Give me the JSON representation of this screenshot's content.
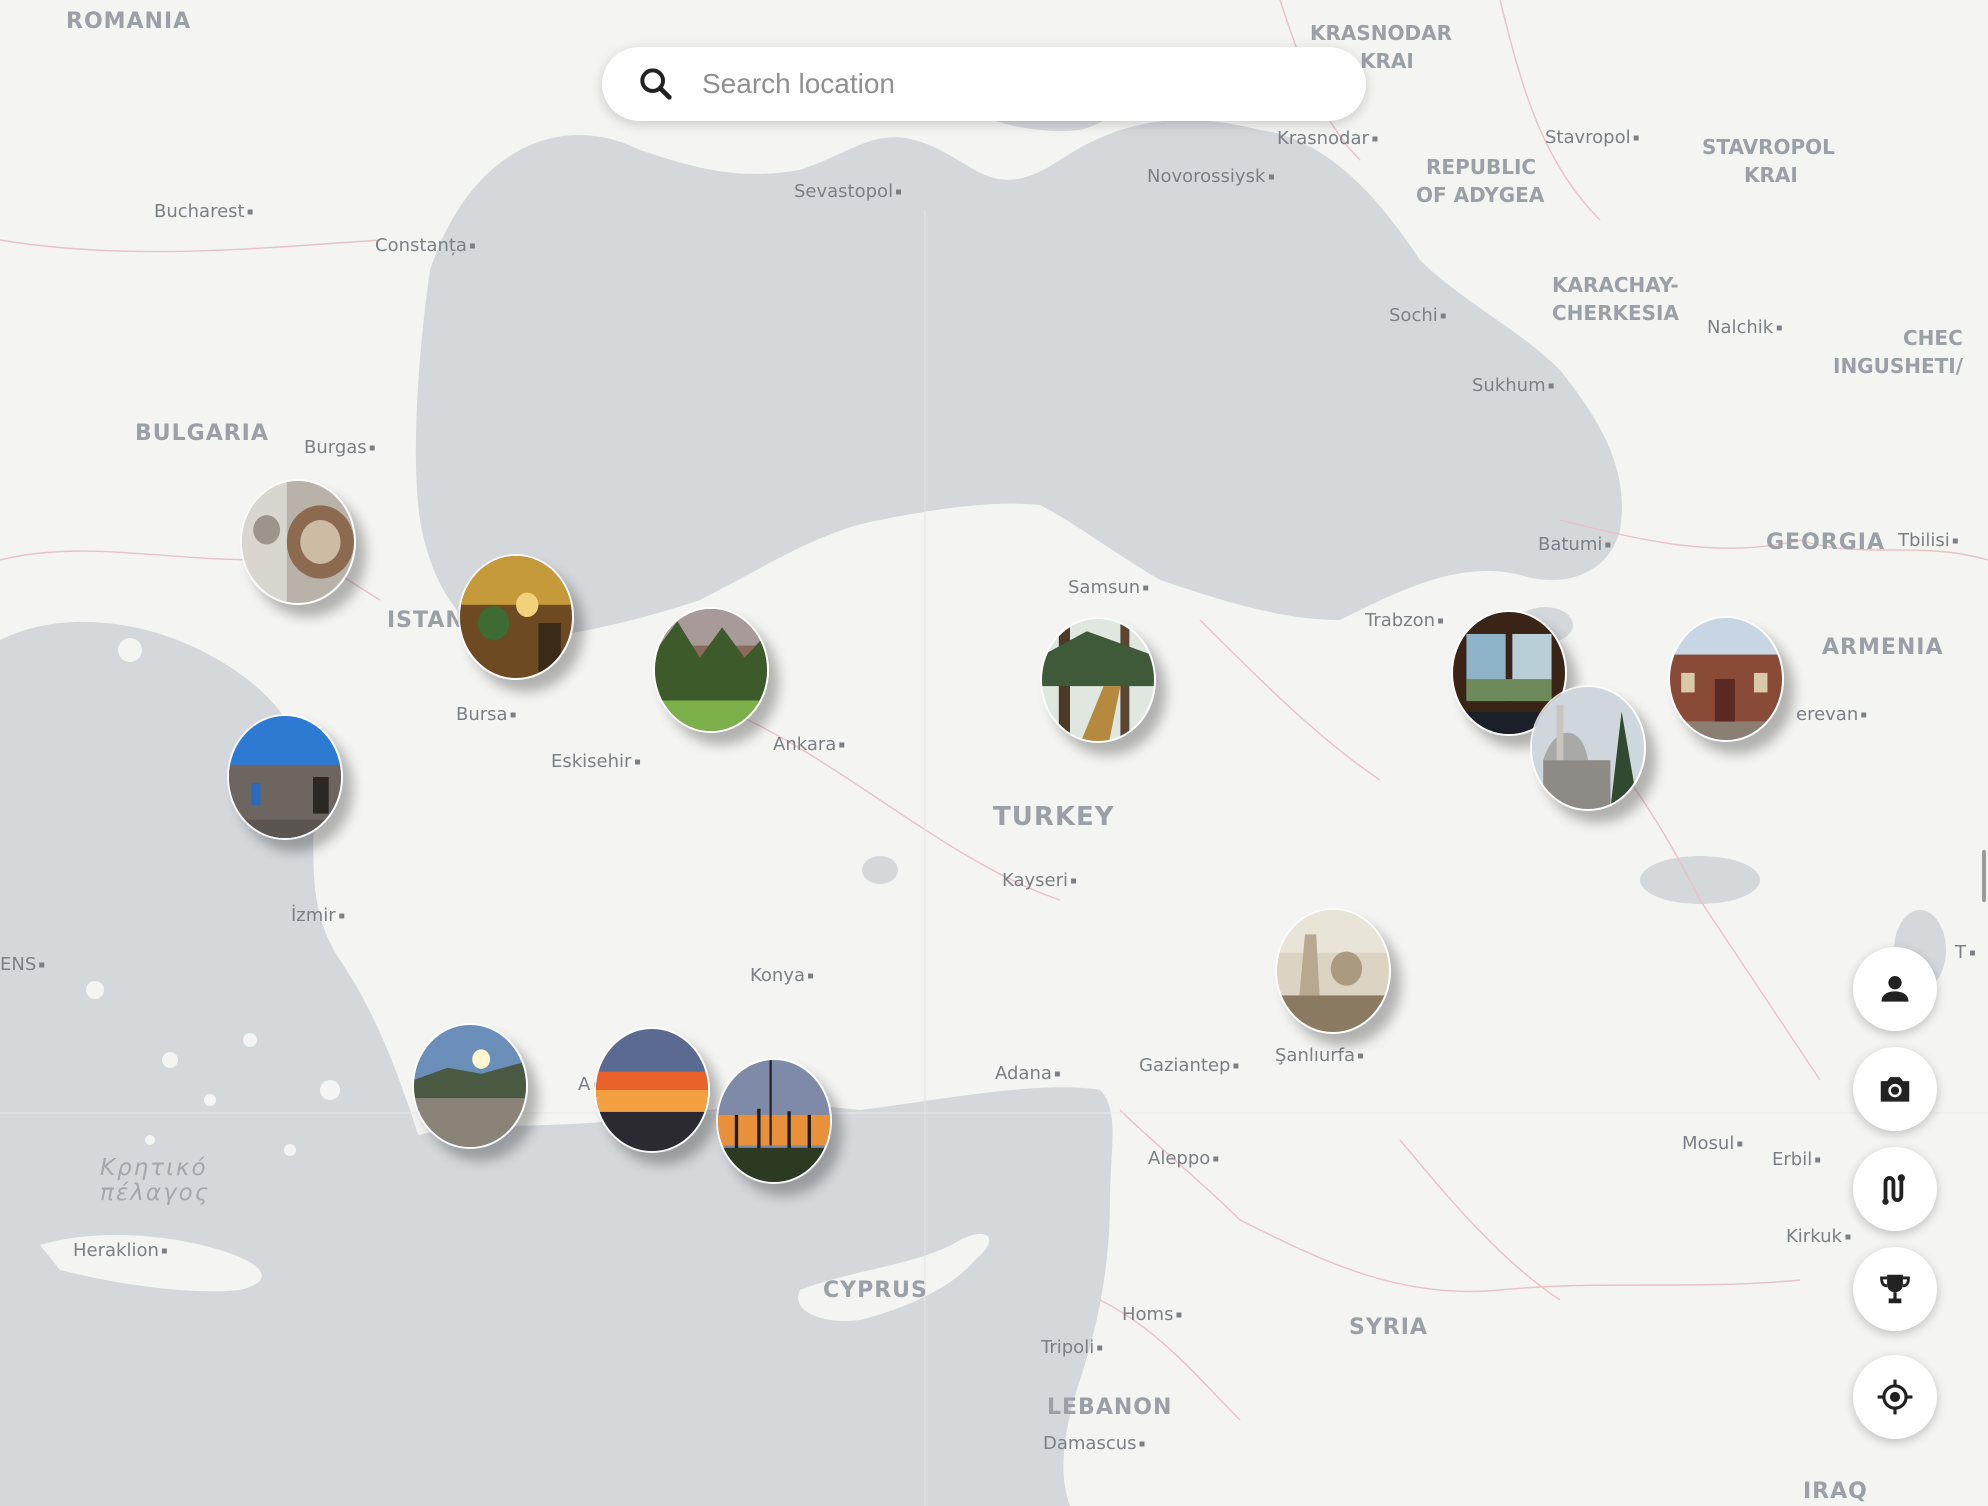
{
  "search": {
    "placeholder": "Search location",
    "icon": "search-icon"
  },
  "map": {
    "countries": {
      "romania": "ROMANIA",
      "bulgaria": "BULGARIA",
      "turkey": "TURKEY",
      "georgia": "GEORGIA",
      "armenia": "ARMENIA",
      "cyprus": "CYPRUS",
      "syria": "SYRIA",
      "lebanon": "LEBANON",
      "iraq": "IRAQ"
    },
    "regions": {
      "krasnodar1": "KRASNODAR",
      "krasnodar2": "KRAI",
      "adygea1": "REPUBLIC",
      "adygea2": "OF ADYGEA",
      "stavropol1": "STAVROPOL",
      "stavropol2": "KRAI",
      "karachay1": "KARACHAY-",
      "karachay2": "CHERKESIA",
      "chech1": "CHEC",
      "chech2": "INGUSHETI/",
      "istan": "ISTAN"
    },
    "sea": {
      "crete1": "Κρητικό",
      "crete2": "πέλαγος"
    },
    "cities": {
      "bucharest": "Bucharest",
      "constanta": "Constanța",
      "burgas": "Burgas",
      "sevastopol": "Sevastopol",
      "krasnodar": "Krasnodar",
      "novorossiysk": "Novorossiysk",
      "stavropol": "Stavropol",
      "sochi": "Sochi",
      "nalchik": "Nalchik",
      "sukhum": "Sukhum",
      "batumi": "Batumi",
      "tbilisi": "Tbilisi",
      "samsun": "Samsun",
      "trabzon": "Trabzon",
      "yerevan": "erevan",
      "bursa": "Bursa",
      "eskisehir": "Eskisehir",
      "ankara": "Ankara",
      "kayseri": "Kayseri",
      "izmir": "İzmir",
      "athens": "ENS",
      "konya": "Konya",
      "adana": "Adana",
      "gaziantep": "Gaziantep",
      "sanliurfa": "Şanlıurfa",
      "aleppo": "Aleppo",
      "mosul": "Mosul",
      "erbil": "Erbil",
      "kirkuk": "Kirkuk",
      "heraklion": "Heraklion",
      "homs": "Homs",
      "tripoli": "Tripoli",
      "damascus": "Damascus",
      "antalya_partial": "A",
      "edge_t": "T"
    }
  },
  "controls": [
    {
      "name": "profile-button",
      "icon": "person-icon"
    },
    {
      "name": "camera-button",
      "icon": "camera-icon"
    },
    {
      "name": "route-button",
      "icon": "route-icon"
    },
    {
      "name": "trophy-button",
      "icon": "trophy-icon"
    },
    {
      "name": "locate-button",
      "icon": "crosshair-icon"
    }
  ],
  "photos": [
    "ornate-dome",
    "mosque-interior",
    "autumn-forest",
    "stone-house",
    "forest-stairs",
    "window-view",
    "mosque-snow",
    "red-brick-building",
    "stone-heads",
    "rocky-sunset",
    "orange-sunset",
    "palm-sunset"
  ],
  "colors": {
    "water": "#d4d8db",
    "land": "#f4f4f2",
    "border": "#e8b8bc"
  }
}
